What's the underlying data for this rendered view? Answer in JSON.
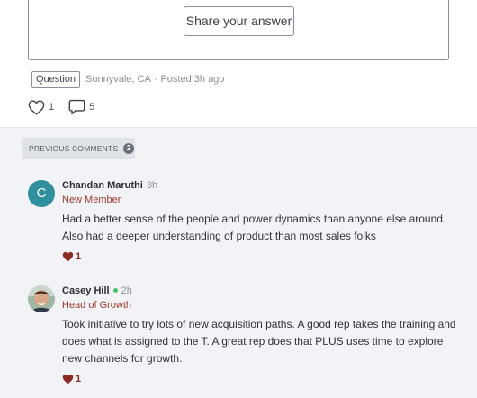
{
  "answer": {
    "share_label": "Share your answer"
  },
  "post_meta": {
    "tag": "Question",
    "location": "Sunnyvale, CA",
    "separator": "·",
    "posted": "Posted 3h ago"
  },
  "actions": {
    "likes": "1",
    "comments": "5"
  },
  "previous_comments": {
    "label": "PREVIOUS COMMENTS",
    "count": "2"
  },
  "comments": [
    {
      "avatar_letter": "C",
      "name": "Chandan Maruthi",
      "time": "3h",
      "role": "New Member",
      "text": "Had a better sense of the people and power dynamics than anyone else around. Also had a deeper understanding of product than most sales folks",
      "likes": "1"
    },
    {
      "name": "Casey Hill",
      "time": "2h",
      "role": "Head of Growth",
      "text": "Took initiative to try lots of new acquisition paths. A good rep takes the training and does what is assigned to the T. A great rep does that PLUS uses time to explore new channels for growth.",
      "likes": "1"
    }
  ],
  "colors": {
    "accent_role": "#a03a2a",
    "heart": "#8b2a22",
    "avatar_c": "#2f8f9d",
    "online": "#4cc16a"
  }
}
